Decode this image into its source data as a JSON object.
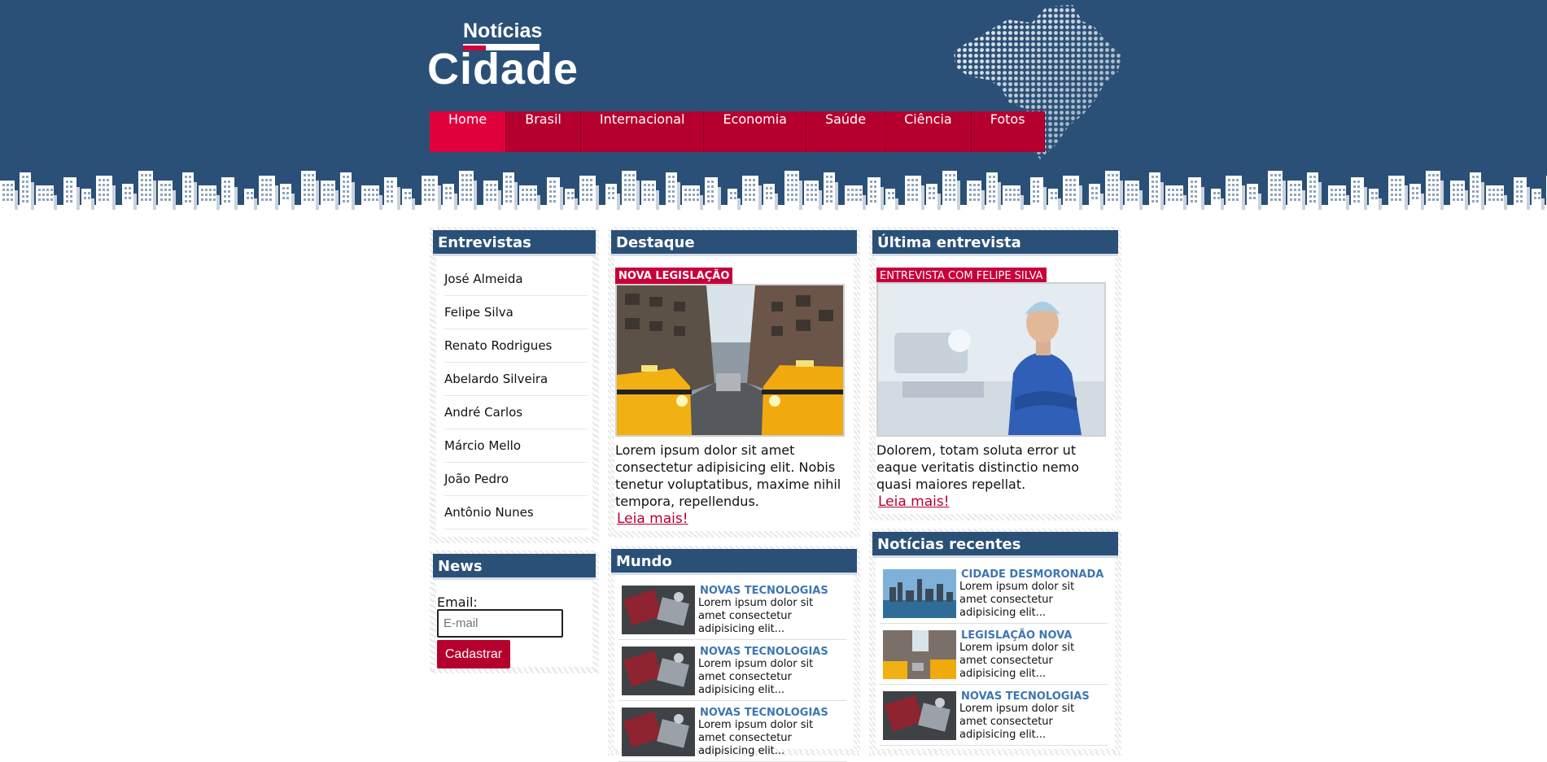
{
  "logo": {
    "top": "Notícias",
    "main": "Cidade"
  },
  "nav": [
    "Home",
    "Brasil",
    "Internacional",
    "Economia",
    "Saúde",
    "Ciência",
    "Fotos"
  ],
  "colors": {
    "header": "#2b5077",
    "accent": "#b5002f",
    "accent_active": "#e0003c",
    "link": "#3e76b0"
  },
  "entrevistas": {
    "title": "Entrevistas",
    "items": [
      "José Almeida",
      "Felipe Silva",
      "Renato Rodrigues",
      "Abelardo Silveira",
      "André Carlos",
      "Márcio Mello",
      "João Pedro",
      "Antônio Nunes"
    ]
  },
  "news": {
    "title": "News",
    "email_label": "Email:",
    "email_placeholder": "E-mail",
    "submit_label": "Cadastrar"
  },
  "destaque": {
    "title": "Destaque",
    "tag": "NOVA LEGISLAÇÃO",
    "text": "Lorem ipsum dolor sit amet consectetur adipisicing elit. Nobis tenetur voluptatibus, maxime nihil tempora, repellendus.",
    "more": "Leia mais!"
  },
  "mundo": {
    "title": "Mundo",
    "items": [
      {
        "title": "NOVAS TECNOLOGIAS",
        "text": "Lorem ipsum dolor sit amet consectetur adipisicing elit..."
      },
      {
        "title": "NOVAS TECNOLOGIAS",
        "text": "Lorem ipsum dolor sit amet consectetur adipisicing elit..."
      },
      {
        "title": "NOVAS TECNOLOGIAS",
        "text": "Lorem ipsum dolor sit amet consectetur adipisicing elit..."
      }
    ]
  },
  "ultima": {
    "title": "Última entrevista",
    "tag": "ENTREVISTA COM FELIPE SILVA",
    "text": "Dolorem, totam soluta error ut eaque veritatis distinctio nemo quasi maiores repellat.",
    "more": "Leia mais!"
  },
  "recentes": {
    "title": "Notícias recentes",
    "items": [
      {
        "title": "CIDADE DESMORONADA",
        "text": "Lorem ipsum dolor sit amet consectetur adipisicing elit..."
      },
      {
        "title": "LEGISLAÇÃO NOVA",
        "text": "Lorem ipsum dolor sit amet consectetur adipisicing elit..."
      },
      {
        "title": "NOVAS TECNOLOGIAS",
        "text": "Lorem ipsum dolor sit amet consectetur adipisicing elit..."
      }
    ]
  }
}
